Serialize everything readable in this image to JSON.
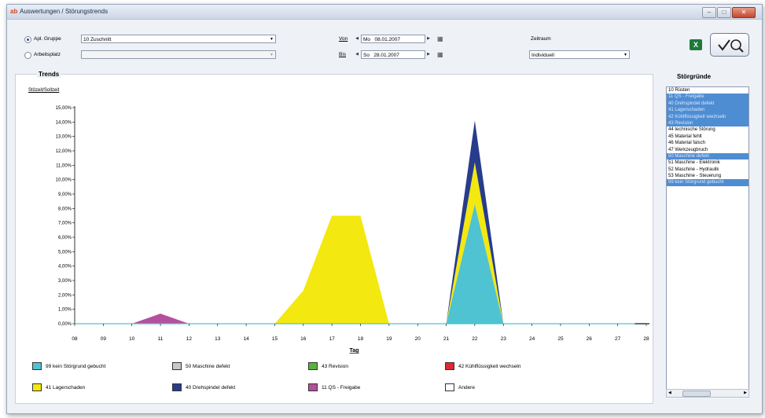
{
  "window": {
    "title": "Auswertungen / Störungstrends",
    "icon_text": "ab",
    "minimize_label": "–",
    "maximize_label": "□",
    "close_label": "✕"
  },
  "filters": {
    "apl_gruppe_label": "Apl. Gruppe",
    "apl_gruppe_value": "10 Zuschnitt",
    "arbeitsplatz_label": "Arbeitsplatz",
    "arbeitsplatz_value": "",
    "von_label": "Von",
    "von_day": "Mo",
    "von_date": "08.01.2007",
    "bis_label": "Bis",
    "bis_day": "So",
    "bis_date": "28.01.2007",
    "zeitraum_label": "Zeitraum",
    "zeitraum_value": "Individuell"
  },
  "toolbar": {
    "excel_icon": "excel-icon",
    "analyze_icon": "checkmark-magnifier-icon"
  },
  "trends": {
    "heading": "Trends",
    "ratio_label": "Stözeit/Sollzeit"
  },
  "stoergruende": {
    "heading": "Störgründe",
    "items": [
      {
        "label": "10 Rüsten",
        "selected": false
      },
      {
        "label": "11 QS - Freigabe",
        "selected": true
      },
      {
        "label": "40 Drehspindel defekt",
        "selected": true
      },
      {
        "label": "41 Lagerschaden",
        "selected": true
      },
      {
        "label": "42 Kühlflüssigkeit wechseln",
        "selected": true
      },
      {
        "label": "43 Revision",
        "selected": true
      },
      {
        "label": "44 technische Störung",
        "selected": false
      },
      {
        "label": "45 Material fehlt",
        "selected": false
      },
      {
        "label": "46 Material falsch",
        "selected": false
      },
      {
        "label": "47 Werkzeugbruch",
        "selected": false
      },
      {
        "label": "50 Maschine defekt",
        "selected": true
      },
      {
        "label": "51 Maschine - Elektronik",
        "selected": false
      },
      {
        "label": "52 Maschine - Hydraulik",
        "selected": false
      },
      {
        "label": "53 Maschine - Steuerung",
        "selected": false
      },
      {
        "label": "99 kein Störgrund gebucht",
        "selected": true
      }
    ]
  },
  "legend": [
    {
      "label": "99 kein Störgrund gebucht",
      "color": "#4fc3d1"
    },
    {
      "label": "50 Maschine defekt",
      "color": "#c8c8c8"
    },
    {
      "label": "43 Revision",
      "color": "#55b43a"
    },
    {
      "label": "42 Kühlflüssigkeit wechseln",
      "color": "#e0282e"
    },
    {
      "label": "41 Lagerschaden",
      "color": "#f3e80f"
    },
    {
      "label": "40 Drehspindel defekt",
      "color": "#283c8c"
    },
    {
      "label": "11 QS - Freigabe",
      "color": "#b4509e"
    },
    {
      "label": "Andere",
      "color": "#ffffff"
    }
  ],
  "chart_data": {
    "type": "area",
    "xlabel": "Tag",
    "ylabel": "Stözeit/Sollzeit",
    "x": [
      8,
      9,
      10,
      11,
      12,
      13,
      14,
      15,
      16,
      17,
      18,
      19,
      20,
      21,
      22,
      23,
      24,
      25,
      26,
      27,
      28
    ],
    "x_tick_labels": [
      "08",
      "09",
      "10",
      "11",
      "12",
      "13",
      "14",
      "15",
      "16",
      "17",
      "18",
      "19",
      "20",
      "21",
      "22",
      "23",
      "24",
      "25",
      "26",
      "27",
      "28"
    ],
    "ylim": [
      0,
      15
    ],
    "y_ticks": [
      0,
      1,
      2,
      3,
      4,
      5,
      6,
      7,
      8,
      9,
      10,
      11,
      12,
      13,
      14,
      15
    ],
    "y_tick_labels": [
      "0,00%",
      "1,00%",
      "2,00%",
      "3,00%",
      "4,00%",
      "5,00%",
      "6,00%",
      "7,00%",
      "8,00%",
      "9,00%",
      "10,00%",
      "11,00%",
      "12,00%",
      "13,00%",
      "14,00%",
      "15,00%"
    ],
    "stacked": true,
    "series": [
      {
        "name": "99 kein Störgrund gebucht",
        "color": "#4fc3d1",
        "values": [
          0,
          0,
          0,
          0,
          0,
          0,
          0,
          0,
          0,
          0,
          0,
          0,
          0,
          0,
          8.3,
          0,
          0,
          0,
          0,
          0,
          0
        ]
      },
      {
        "name": "41 Lagerschaden",
        "color": "#f3e80f",
        "values": [
          0,
          0,
          0,
          0,
          0,
          0,
          0,
          0,
          2.3,
          7.5,
          7.5,
          0,
          0,
          0,
          2.9,
          0,
          0,
          0,
          0,
          0,
          0
        ]
      },
      {
        "name": "40 Drehspindel defekt",
        "color": "#283c8c",
        "values": [
          0,
          0,
          0,
          0,
          0,
          0,
          0,
          0,
          0,
          0,
          0,
          0,
          0,
          0,
          2.9,
          0,
          0,
          0,
          0,
          0,
          0
        ]
      },
      {
        "name": "11 QS - Freigabe",
        "color": "#b4509e",
        "values": [
          0,
          0,
          0,
          0.7,
          0,
          0,
          0,
          0,
          0,
          0,
          0,
          0,
          0,
          0,
          0,
          0,
          0,
          0,
          0,
          0,
          0
        ]
      }
    ]
  }
}
